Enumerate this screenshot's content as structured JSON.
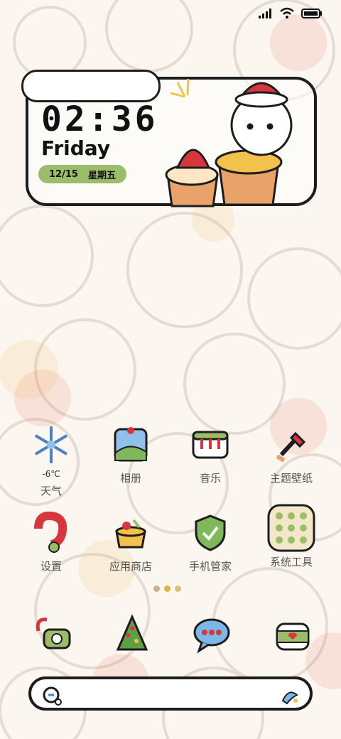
{
  "clock": {
    "time": "02:36",
    "day": "Friday",
    "date": "12/15",
    "weekday": "星期五"
  },
  "apps": [
    {
      "name": "weather",
      "label": "天气",
      "temp": "-6℃",
      "icon": "snowflake-icon"
    },
    {
      "name": "gallery",
      "label": "相册",
      "icon": "photo-album-icon"
    },
    {
      "name": "music",
      "label": "音乐",
      "icon": "piano-icon"
    },
    {
      "name": "themes",
      "label": "主题壁纸",
      "icon": "paint-brush-icon"
    },
    {
      "name": "settings",
      "label": "设置",
      "icon": "settings-ring-icon"
    },
    {
      "name": "appstore",
      "label": "应用商店",
      "icon": "gift-basket-icon"
    },
    {
      "name": "security",
      "label": "手机管家",
      "icon": "shield-check-icon"
    },
    {
      "name": "tools",
      "label": "系统工具",
      "icon": "tools-folder-icon"
    }
  ],
  "dock": [
    {
      "name": "phone",
      "icon": "telephone-icon"
    },
    {
      "name": "browser",
      "icon": "christmas-tree-icon"
    },
    {
      "name": "messages",
      "icon": "chat-bubble-icon"
    },
    {
      "name": "camera",
      "icon": "camera-jar-icon"
    }
  ],
  "colors": {
    "accent_green": "#9bbd6a",
    "red": "#d8363d",
    "outline": "#1d1d1d"
  }
}
